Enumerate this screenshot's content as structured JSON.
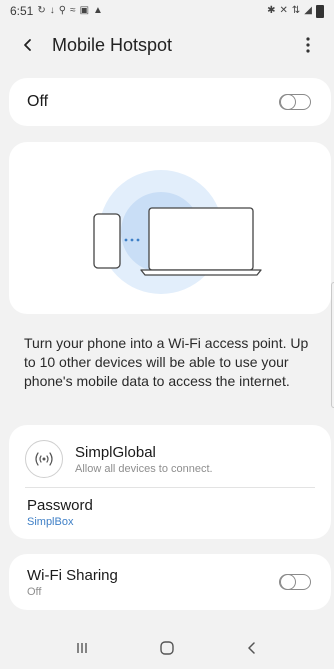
{
  "status_bar": {
    "time": "6:51",
    "left_icons": [
      "sync-icon",
      "download-icon",
      "search-icon",
      "wifi-off-icon",
      "image-icon",
      "bag-icon"
    ],
    "right_icons": [
      "bluetooth-icon",
      "mute-icon",
      "lte-icon",
      "signal-icon",
      "battery-icon"
    ]
  },
  "app_bar": {
    "title": "Mobile Hotspot"
  },
  "hotspot_toggle": {
    "label": "Off",
    "state": "off"
  },
  "description": "Turn your phone into a Wi-Fi access point. Up to 10 other devices will be able to use your phone's mobile data to access the internet.",
  "network": {
    "name": "SimplGlobal",
    "subtitle": "Allow all devices to connect."
  },
  "password": {
    "label": "Password",
    "value": "SimplBox"
  },
  "wifi_sharing": {
    "label": "Wi-Fi Sharing",
    "value": "Off",
    "state": "off"
  },
  "colors": {
    "accent": "#3e7fc6",
    "background": "#f2f2f2",
    "card": "#ffffff",
    "illustration_circle_outer": "#e2eefb",
    "illustration_circle_inner": "#c9def6"
  },
  "nav_bar": {
    "items": [
      "recent-apps-icon",
      "home-icon",
      "back-icon"
    ]
  }
}
